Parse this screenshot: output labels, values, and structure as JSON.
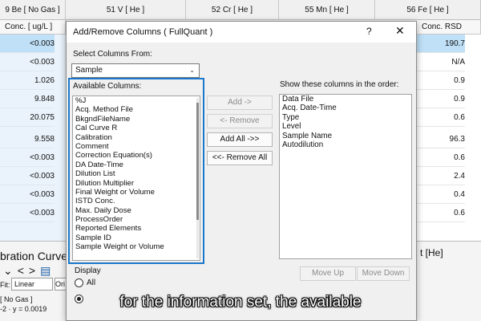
{
  "background": {
    "column_headers": [
      "9  Be  [ No Gas ]",
      "51  V  [ He ]",
      "52  Cr  [ He ]",
      "55  Mn  [ He ]",
      "56  Fe  [ He ]"
    ],
    "subheader_left": "Conc. [ ug/L ]",
    "subheader_right": "Conc. RSD",
    "left_values": [
      "<0.003",
      "<0.003",
      "1.026",
      "9.848",
      "20.075",
      "9.558",
      "<0.003",
      "<0.003",
      "<0.003",
      "<0.003"
    ],
    "right_values": [
      "190.7",
      "N/A",
      "0.9",
      "0.9",
      "0.6",
      "96.3",
      "0.6",
      "2.4",
      "0.4",
      "0.6"
    ],
    "calibration_title": "bration Curve",
    "fit_label": "Fit:",
    "fit_value": "Linear",
    "origin_value": "Ori",
    "no_gas_label": "[ No Gas ]",
    "equation_label": "-2 · y = 0.0019",
    "he_label": "t [He]"
  },
  "dialog": {
    "title": "Add/Remove Columns ( FullQuant )",
    "help_glyph": "?",
    "close_glyph": "✕",
    "select_from_label": "Select Columns From:",
    "select_from_value": "Sample",
    "available_label": "Available Columns:",
    "available_columns": [
      "%J",
      "Acq. Method File",
      "BkgndFileName",
      "Cal Curve R",
      "Calibration",
      "Comment",
      "Correction Equation(s)",
      "DA Date-Time",
      "Dilution List",
      "Dilution Multiplier",
      "Final Weight or Volume",
      "ISTD Conc.",
      "Max. Daily Dose",
      "ProcessOrder",
      "Reported Elements",
      "Sample ID",
      "Sample Weight or Volume"
    ],
    "add_button": "Add ->",
    "remove_button": "<- Remove",
    "add_all_button": "Add All ->>",
    "remove_all_button": "<<- Remove All",
    "show_label": "Show these columns in the order:",
    "shown_columns": [
      "Data File",
      "Acq. Date-Time",
      "Type",
      "Level",
      "Sample Name",
      "Autodilution"
    ],
    "move_up_button": "Move Up",
    "move_down_button": "Move Down",
    "display_label": "Display",
    "display_all": "All"
  },
  "caption": "for the information set, the available"
}
